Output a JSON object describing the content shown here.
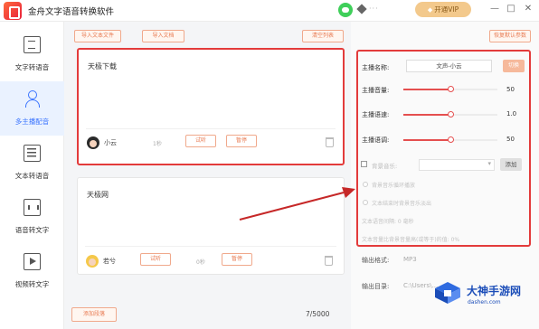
{
  "app": {
    "title": "金舟文字语音转换软件",
    "vip_label": "开通VIP",
    "user_masked": "···"
  },
  "window": {
    "min": "—",
    "max": "□",
    "close": "✕"
  },
  "sidebar": {
    "items": [
      {
        "label": "文字转语音",
        "icon": "text-doc-icon"
      },
      {
        "label": "多主播配音",
        "icon": "person-icon",
        "active": true
      },
      {
        "label": "文本转语音",
        "icon": "text-lines-icon"
      },
      {
        "label": "语音转文字",
        "icon": "audio-wave-icon"
      },
      {
        "label": "视频转文字",
        "icon": "video-icon"
      }
    ]
  },
  "toolbar": {
    "import_text": "导入文本文件",
    "import_doc": "导入文档",
    "clear_all": "清空列表",
    "restore_default": "恢复默认参数"
  },
  "cards": [
    {
      "text": "天极下载",
      "voice": "小云",
      "duration": "1秒",
      "listen": "试听",
      "pause": "暂停"
    },
    {
      "text": "天极网",
      "voice": "若兮",
      "duration": "0秒",
      "listen": "试听",
      "pause": "暂停"
    }
  ],
  "add_button": "添加段落",
  "char_count": "7/5000",
  "settings": {
    "anchor_name_label": "主播名称:",
    "anchor_name_value": "文声-小云",
    "switch_label": "切换",
    "volume_label": "主播音量:",
    "volume_value": "50",
    "speed_label": "主播语速:",
    "speed_value": "1.0",
    "pitch_label": "主播语调:",
    "pitch_value": "50",
    "bg_music_label": "背景音乐:",
    "bg_add": "添加",
    "opt1": "背景音乐循环播放",
    "opt2": "文本结束时背景音乐淡出",
    "opt3": "文本语音间隔: 0 毫秒",
    "opt4": "文本音量比背景音量高(或等于)的值: 0%",
    "slider_levels": {
      "volume": 0.5,
      "speed": 0.5,
      "pitch": 0.5
    }
  },
  "output": {
    "format_label": "输出格式:",
    "format_value": "MP3",
    "dir_label": "输出目录:",
    "dir_value": "C:\\Users\\..."
  },
  "watermark": {
    "name": "大神手游网",
    "domain": "dashen.com"
  },
  "colors": {
    "accent": "#3a74ff",
    "warn": "#e87a51",
    "highlight": "#e33b3b",
    "vip": "#f3c98c"
  }
}
